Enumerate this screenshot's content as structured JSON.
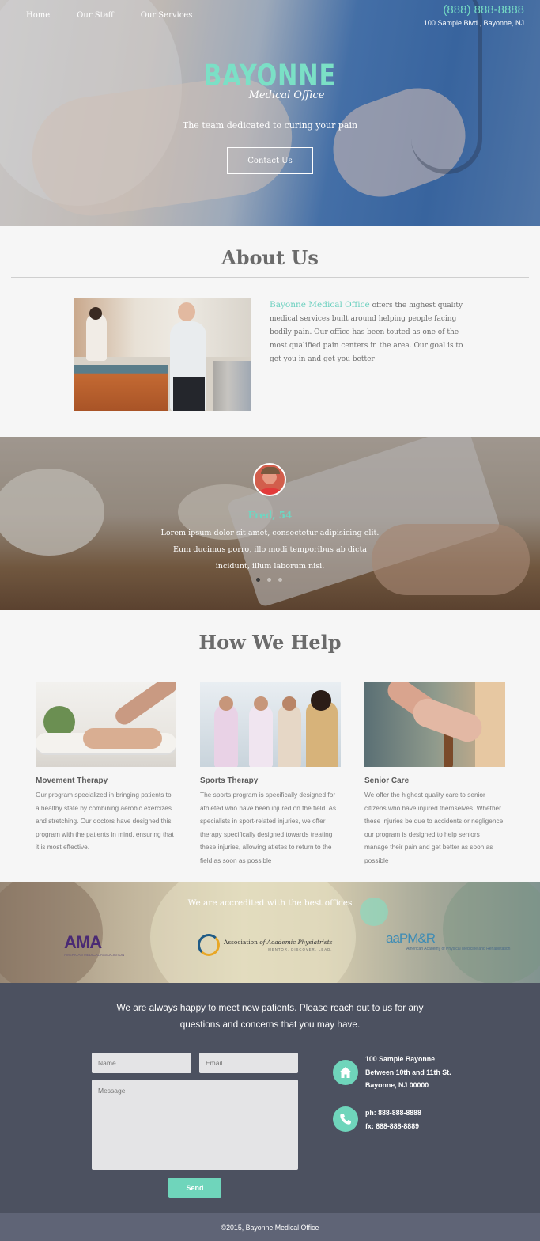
{
  "nav": {
    "items": [
      {
        "label": "Home"
      },
      {
        "label": "Our Staff"
      },
      {
        "label": "Our Services"
      }
    ]
  },
  "hero": {
    "phone": "(888) 888-8888",
    "address": "100 Sample Blvd., Bayonne, NJ",
    "brand_name": "BAYONNE",
    "brand_sub": "Medical Office",
    "tagline": "The team dedicated to curing your pain",
    "cta_label": "Contact Us"
  },
  "about": {
    "title": "About Us",
    "highlight": "Bayonne Medical Office",
    "body": " offers the highest quality medical services built around helping people facing bodily pain. Our office has been touted as one of the most qualified pain centers in the area. Our goal is to get you in and get you better"
  },
  "testimonial": {
    "name": "Fred, 54",
    "quote": "Lorem ipsum dolor sit amet, consectetur adipisicing elit. Eum ducimus porro, illo modi temporibus ab dicta incidunt, illum laborum nisi.",
    "active_slide": 1,
    "slide_count": 3
  },
  "help": {
    "title": "How We Help",
    "cards": [
      {
        "title": "Movement Therapy",
        "text": "Our program specialized in bringing patients to a healthy state by combining aerobic exercizes and stretching. Our doctors have designed this program with the patients in mind, ensuring that it is most effective."
      },
      {
        "title": "Sports Therapy",
        "text": "The sports program is specifically designed for athleted who have been injured on the field. As specialists in sport-related injuries, we offer therapy specifically designed towards treating these injuries, allowing atletes to return to the field as soon as possible"
      },
      {
        "title": "Senior Care",
        "text": "We offer the highest quality care to senior citizens who have injured themselves. Whether these injuries be due to accidents or negligence, our program is designed to help seniors manage their pain and get better as soon as possible"
      }
    ]
  },
  "accredited": {
    "title": "We are accredited with the best offices",
    "logos": {
      "ama_big": "AMA",
      "ama_small": "AMERICAN MEDICAL ASSOCIATION",
      "aap_name_1": "Association ",
      "aap_name_2": "of Academic Physiatrists",
      "aap_motto": "MENTOR. DISCOVER. LEAD.",
      "aapmr_big": "aaPM&R",
      "aapmr_small": "American Academy of Physical Medicine and Rehabilitation"
    }
  },
  "contact": {
    "intro": "We are always happy to meet new patients. Please reach out to us for any questions and concerns that you may have.",
    "name_placeholder": "Name",
    "email_placeholder": "Email",
    "message_placeholder": "Message",
    "send_label": "Send",
    "address_lines": [
      "100 Sample Bayonne",
      "Between 10th and 11th St.",
      "Bayonne, NJ 00000"
    ],
    "phone_line": "ph: 888-888-8888",
    "fax_line": "fx: 888-888-8889",
    "accent_color": "#6fd5bb"
  },
  "footer": {
    "text": "©2015, Bayonne Medical Office"
  }
}
